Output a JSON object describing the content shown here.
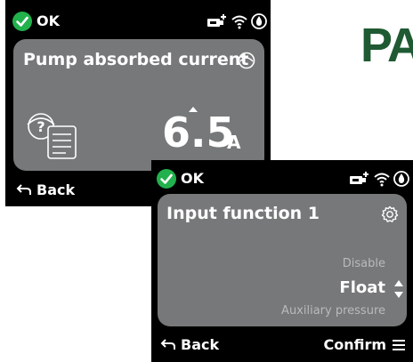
{
  "brand": {
    "text": "PA",
    "color": "#1f5a33"
  },
  "status_ok_color": "#22b14c",
  "screen1": {
    "status": {
      "ok_label": "OK",
      "icons": [
        "pump-plus-icon",
        "wifi-icon",
        "water-drop-icon"
      ]
    },
    "title": "Pump absorbed current",
    "title_icon": "pump-outline-icon",
    "help_icon": "question-document-icon",
    "value": "6.5",
    "unit": "A",
    "footer": {
      "back_label": "Back"
    }
  },
  "screen2": {
    "status": {
      "ok_label": "OK",
      "icons": [
        "pump-plus-icon",
        "wifi-icon",
        "water-drop-icon"
      ]
    },
    "title": "Input function 1",
    "title_icon": "gear-icon",
    "options": {
      "previous": "Disable",
      "selected": "Float",
      "next": "Auxiliary pressure"
    },
    "footer": {
      "back_label": "Back",
      "confirm_label": "Confirm"
    }
  },
  "colors": {
    "panel": "#767879",
    "screen_bg": "#000000",
    "text": "#ffffff",
    "muted_text": "#b8babb"
  }
}
